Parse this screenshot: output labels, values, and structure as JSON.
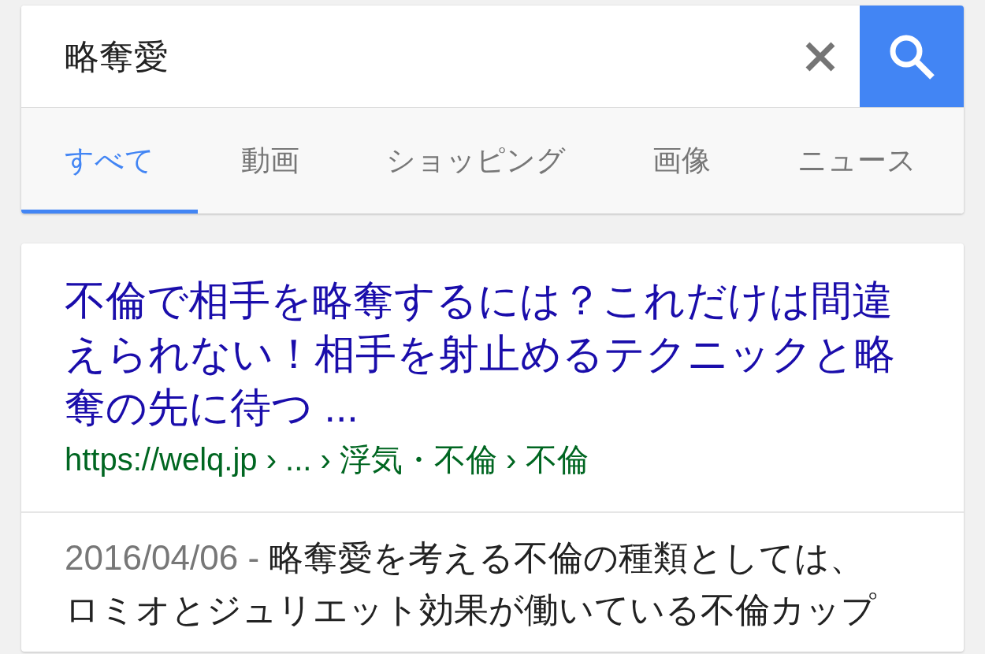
{
  "search": {
    "value": "略奪愛"
  },
  "tabs": [
    {
      "label": "すべて",
      "selected": true
    },
    {
      "label": "動画",
      "selected": false
    },
    {
      "label": "ショッピング",
      "selected": false
    },
    {
      "label": "画像",
      "selected": false
    },
    {
      "label": "ニュース",
      "selected": false
    }
  ],
  "result": {
    "title": "不倫で相手を略奪するには？これだけは間違えられない！相手を射止めるテクニックと略奪の先に待つ ...",
    "url": "https://welq.jp › ... › 浮気・不倫 › 不倫",
    "date": "2016/04/06 -",
    "snippet": "略奪愛を考える不倫の種類としては、ロミオとジュリエット効果が働いている不倫カップ"
  }
}
